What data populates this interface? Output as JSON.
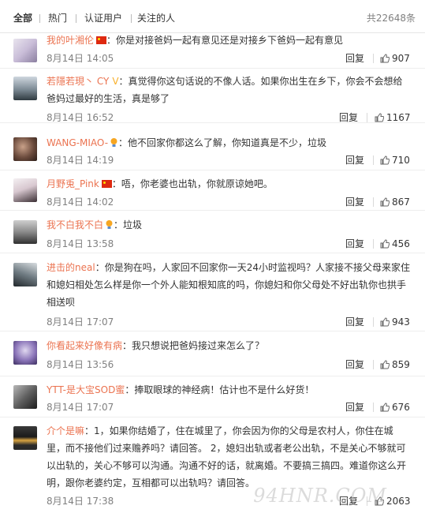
{
  "tabs": {
    "all": "全部",
    "hot": "热门",
    "verified": "认证用户",
    "following": "关注的人",
    "total": "共22648条"
  },
  "actions": {
    "reply": "回复"
  },
  "comments": [
    {
      "user": "我的叶湘伦",
      "badge": "cn-flag",
      "text": "：你是对接爸妈一起有意见还是对接乡下爸妈一起有意见",
      "time": "8月14日 14:05",
      "likes": "907"
    },
    {
      "user": "若隱若現丶 CY",
      "badge": "vip-icon",
      "text": "：真觉得你这句话说的不像人话。如果你出生在乡下，你会不会想给爸妈过最好的生活，真是够了",
      "time": "8月14日 16:52",
      "likes": "1167"
    },
    {
      "user": "WANG-MIAO-",
      "badge": "bulb-icon",
      "text": "：他不回家你都这么了解，你知道真是不少，垃圾",
      "time": "8月14日 14:19",
      "likes": "710"
    },
    {
      "user": "月野兎_Pink",
      "badge": "cn-flag",
      "text": "：唔，你老婆也出轨，你就原谅她吧。",
      "time": "8月14日 14:02",
      "likes": "867"
    },
    {
      "user": "我不白我不白",
      "badge": "bulb-icon",
      "text": "：垃圾",
      "time": "8月14日 13:58",
      "likes": "456"
    },
    {
      "user": "进击的neal",
      "badge": "",
      "text": "：你是狗在吗，人家回不回家你一天24小时监视吗？人家接不接父母来家住和媳妇相处怎么样是你一个外人能知根知底的吗，你媳妇和你父母处不好出轨你也拱手相送呗",
      "time": "8月14日 17:07",
      "likes": "943"
    },
    {
      "user": "你看起来好像有病",
      "badge": "",
      "text": "：我只想说把爸妈接过来怎么了？",
      "time": "8月14日 13:56",
      "likes": "859"
    },
    {
      "user": "YTT-是大宝SOD蜜",
      "badge": "",
      "text": "：捧取眼球的神经病！估计也不是什么好货！",
      "time": "8月14日 17:07",
      "likes": "676"
    },
    {
      "user": "介个是嘛",
      "badge": "",
      "text": "：1，如果你结婚了，住在城里了，你会因为你的父母是农村人，你住在城里，而不接他们过来赡养吗？请回答。 2，媳妇出轨或者老公出轨，不是关心不够就可以出轨的，关心不够可以沟通。沟通不好的话，就离婚。不要搞三搞四。难道你这么开明，跟你老婆约定，互相都可以出轨吗？请回答。",
      "time": "8月14日 17:38",
      "likes": "2063"
    }
  ],
  "watermark": "94HNR.COM",
  "colors": {
    "username": "#eb7350",
    "meta": "#808080",
    "text": "#333333"
  }
}
